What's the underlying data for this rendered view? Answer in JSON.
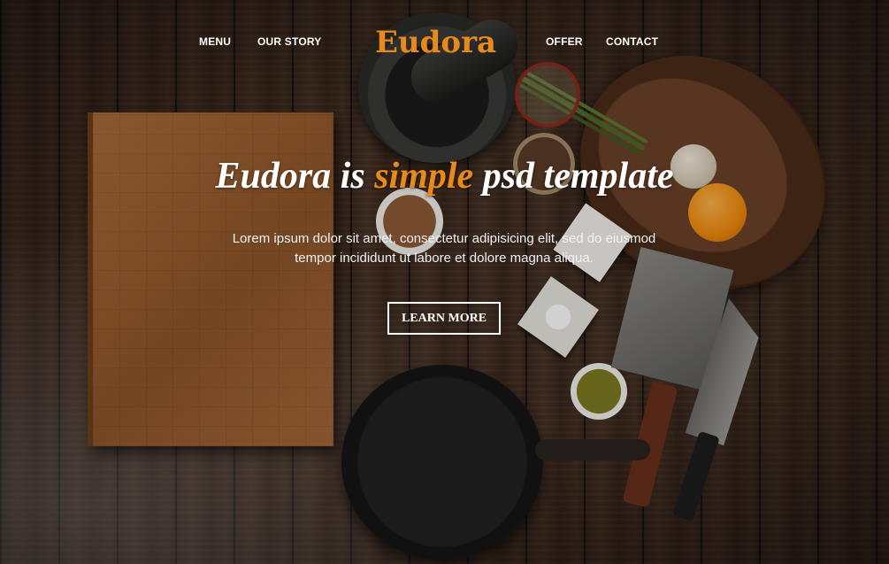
{
  "nav": {
    "left_items": [
      "MENU",
      "OUR STORY"
    ],
    "right_items": [
      "OFFER",
      "CONTACT"
    ],
    "logo": "Eudora"
  },
  "hero": {
    "headline_before": "Eudora is ",
    "headline_accent": "simple",
    "headline_after": " psd template",
    "description": "Lorem ipsum dolor sit amet, consectetur adipisicing elit, sed do eiusmod tempor incididunt ut labore et dolore magna aliqua.",
    "cta_label": "LEARN MORE"
  },
  "colors": {
    "accent": "#e8891b",
    "text": "#ffffff"
  }
}
